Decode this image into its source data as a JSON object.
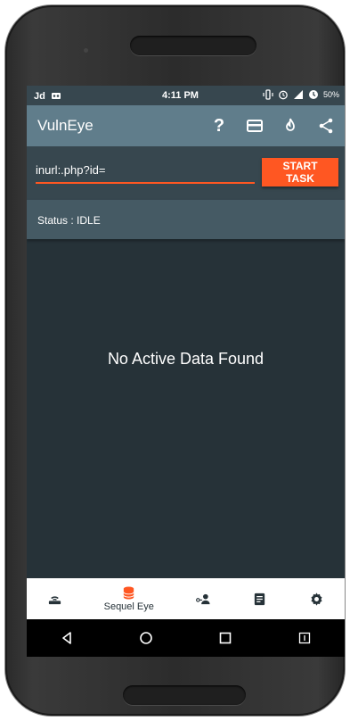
{
  "statusbar": {
    "carrier": "Jd",
    "time": "4:11 PM",
    "battery": "50%"
  },
  "appbar": {
    "title": "VulnEye",
    "actions": [
      "help-icon",
      "card-icon",
      "fire-icon",
      "share-icon"
    ],
    "help_label": "?"
  },
  "search": {
    "value": "inurl:.php?id=",
    "button_label": "START TASK"
  },
  "status": {
    "text": "Status : IDLE"
  },
  "main": {
    "empty_message": "No Active Data Found"
  },
  "bottom_nav": {
    "active_label": "Sequel Eye",
    "items": [
      "router-icon",
      "database-icon",
      "user-key-icon",
      "document-icon",
      "gear-icon"
    ]
  },
  "system_nav": [
    "back-icon",
    "home-icon",
    "recents-icon",
    "menu-icon"
  ],
  "colors": {
    "appbar": "#607d8b",
    "background": "#263238",
    "accent": "#ff5722",
    "status_row": "#455a64"
  }
}
